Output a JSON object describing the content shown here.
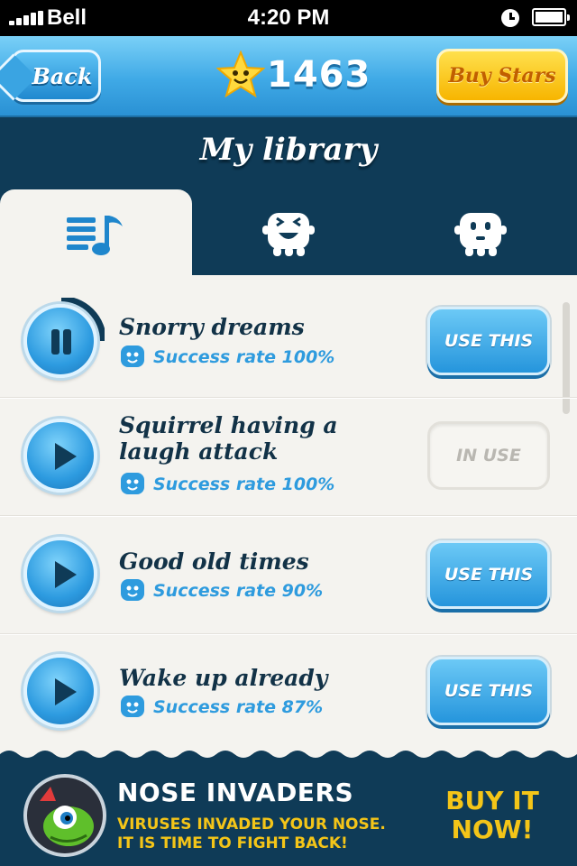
{
  "status_bar": {
    "carrier": "Bell",
    "time": "4:20 PM"
  },
  "navbar": {
    "back_label": "Back",
    "stars": "1463",
    "buy_stars_label": "Buy Stars"
  },
  "page": {
    "title": "My library"
  },
  "tabs": [
    {
      "icon": "music-list-icon",
      "active": true
    },
    {
      "icon": "happy-monster-icon",
      "active": false
    },
    {
      "icon": "neutral-monster-icon",
      "active": false
    }
  ],
  "songs": [
    {
      "title": "Snorry dreams",
      "rate": "Success rate 100%",
      "action": "USE THIS",
      "state": "playing",
      "progress": 0.25
    },
    {
      "title": "Squirrel having a laugh attack",
      "rate": "Success rate 100%",
      "action": "IN USE",
      "state": "stopped"
    },
    {
      "title": "Good old times",
      "rate": "Success rate 90%",
      "action": "USE THIS",
      "state": "stopped"
    },
    {
      "title": "Wake up already",
      "rate": "Success rate 87%",
      "action": "USE THIS",
      "state": "stopped"
    }
  ],
  "banner": {
    "title": "NOSE INVADERS",
    "subtitle_line1": "VIRUSES INVADED YOUR NOSE.",
    "subtitle_line2": "IT IS TIME TO FIGHT BACK!",
    "cta_line1": "BUY IT",
    "cta_line2": "NOW!"
  },
  "colors": {
    "accent": "#2e9bde",
    "dark": "#0f3b57",
    "gold": "#f4c518"
  }
}
